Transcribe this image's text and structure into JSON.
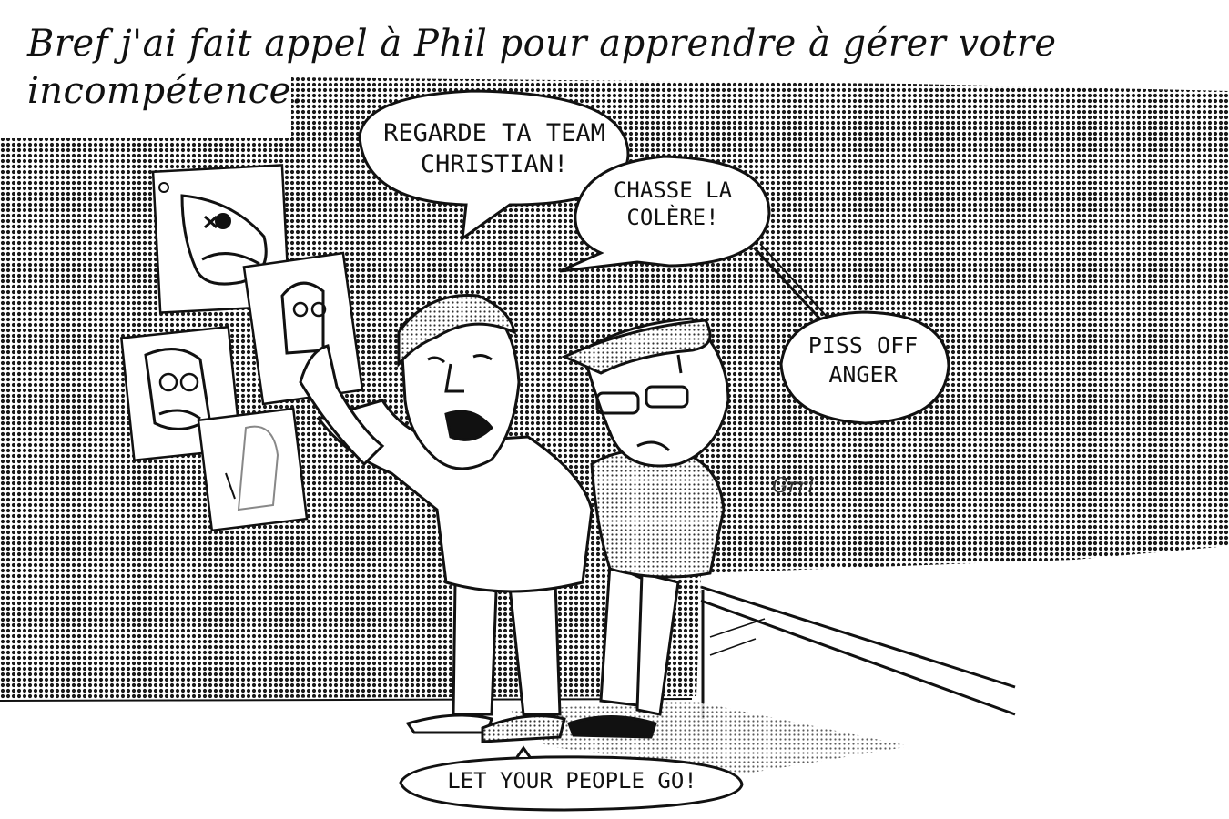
{
  "caption": "Bref j'ai fait appel à Phil pour apprendre à gérer votre incompétence.",
  "bubbles": {
    "regarde": "REGARDE TA TEAM CHRISTIAN!",
    "chasse": "CHASSE LA COLÈRE!",
    "piss_off": "PISS OFF ANGER",
    "let_your_people": "LET YOUR PEOPLE GO!"
  },
  "sound_effect": "Grr!",
  "colors": {
    "ink": "#111111",
    "halftone": "#2b2b2b",
    "paper": "#ffffff"
  }
}
